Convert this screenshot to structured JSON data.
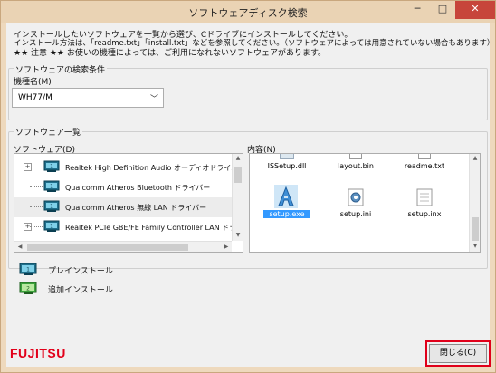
{
  "window": {
    "title": "ソフトウェアディスク検索",
    "min_glyph": "─",
    "max_glyph": "□",
    "close_glyph": "✕"
  },
  "intro": [
    "インストールしたいソフトウェアを一覧から選び、Cドライブにインストールしてください。",
    "インストール方法は、「readme.txt」「install.txt」などを参照してください。（ソフトウェアによっては用意されていない場合もあります）",
    "★★ 注意 ★★ お使いの機種によっては、ご利用になれないソフトウェアがあります。"
  ],
  "search": {
    "group_label": "ソフトウェアの検索条件",
    "model_label": "機種名(M)",
    "model_value": "WH77/M"
  },
  "list": {
    "group_label": "ソフトウェア一覧",
    "software_label": "ソフトウェア(D)",
    "items": [
      {
        "label": "Realtek High Definition Audio オーディオドライバー",
        "expander": "+"
      },
      {
        "label": "Qualcomm Atheros Bluetooth ドライバー",
        "expander": ""
      },
      {
        "label": "Qualcomm Atheros 無線 LAN ドライバー",
        "expander": ""
      },
      {
        "label": "Realtek PCIe GBE/FE Family Controller LAN ドライバー",
        "expander": "+"
      }
    ],
    "contents_label": "内容(N)",
    "files": [
      {
        "name": "ISSetup.dll",
        "icon": "dll-file-icon"
      },
      {
        "name": "layout.bin",
        "icon": "bin-file-icon"
      },
      {
        "name": "readme.txt",
        "icon": "text-file-icon"
      },
      {
        "name": "setup.exe",
        "icon": "setup-exe-icon"
      },
      {
        "name": "setup.ini",
        "icon": "settings-file-icon"
      },
      {
        "name": "setup.inx",
        "icon": "inx-file-icon"
      }
    ],
    "selected_file": "setup.exe"
  },
  "legend": [
    {
      "label": "プレインストール",
      "icon": "preinstall-icon"
    },
    {
      "label": "追加インストール",
      "icon": "additional-install-icon"
    }
  ],
  "footer": {
    "brand": "FUJITSU",
    "close_label": "閉じる(C)"
  },
  "colors": {
    "title_bar": "#ead3b4",
    "close_caption": "#c7453b",
    "brand_red": "#e2001a",
    "highlight_box": "#e0001a",
    "preinstall_icon": "#1f6f8b",
    "additional_icon": "#3aa23a"
  }
}
